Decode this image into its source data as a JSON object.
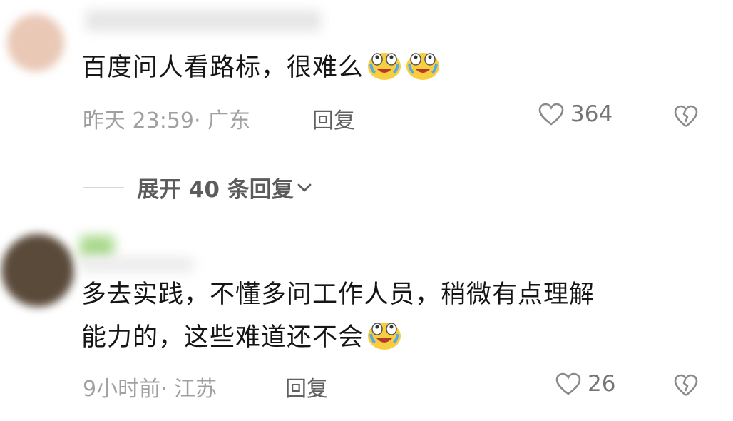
{
  "comments": [
    {
      "text": "百度问人看路标，很难么",
      "emojis": [
        "laugh-cry-icon",
        "laugh-cry-icon"
      ],
      "time": "昨天 23:59",
      "location": "· 广东",
      "reply_label": "回复",
      "likes": "364"
    },
    {
      "text_line1": "多去实践，不懂多问工作人员，稍微有点理解",
      "text_line2": "能力的，这些难道还不会",
      "emojis": [
        "laugh-cry-icon"
      ],
      "time": "9小时前",
      "location": "· 江苏",
      "reply_label": "回复",
      "likes": "26"
    }
  ],
  "expand_replies": {
    "label": "展开 40 条回复"
  },
  "colors": {
    "text": "#151515",
    "meta": "#a0a0a0",
    "reply": "#616161",
    "emoji_face": "#f7cf3e"
  }
}
